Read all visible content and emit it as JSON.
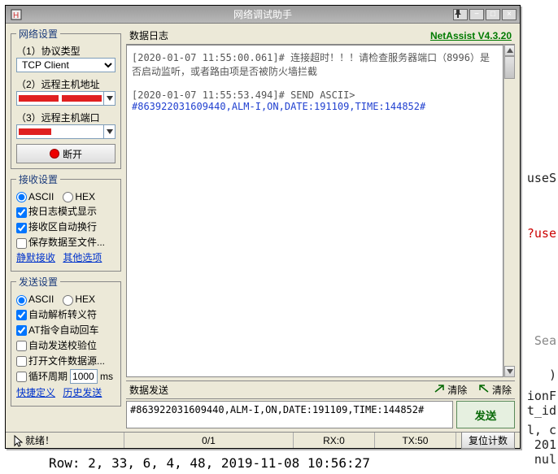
{
  "window": {
    "title": "网络调试助手",
    "version_label": "NetAssist V4.3.20"
  },
  "titlebar_buttons": {
    "pin": "pin-icon",
    "min": "−",
    "max": "□",
    "close": "×"
  },
  "network": {
    "legend": "网络设置",
    "protocol_label": "（1）协议类型",
    "protocol_value": "TCP Client",
    "host_label": "（2）远程主机地址",
    "port_label": "（3）远程主机端口",
    "disconnect_label": "断开"
  },
  "recv": {
    "legend": "接收设置",
    "ascii": "ASCII",
    "hex": "HEX",
    "log_mode": "按日志模式显示",
    "autowrap": "接收区自动换行",
    "save_file": "保存数据至文件...",
    "silent": "静默接收",
    "other": "其他选项"
  },
  "send": {
    "legend": "发送设置",
    "ascii": "ASCII",
    "hex": "HEX",
    "escape": "自动解析转义符",
    "at_return": "AT指令自动回车",
    "checksum": "自动发送校验位",
    "open_file": "打开文件数据源...",
    "loop_label": "循环周期",
    "loop_value": "1000",
    "loop_unit": "ms",
    "quick": "快捷定义",
    "history": "历史发送"
  },
  "log": {
    "header": "数据日志",
    "line1": "[2020-01-07 11:55:00.061]# 连接超时！！！请检查服务器端口（8996）是否启动监听，或者路由项是否被防火墙拦截",
    "line2_head": "[2020-01-07 11:55:53.494]# SEND ASCII>",
    "line2_body": "#863922031609440,ALM-I,ON,DATE:191109,TIME:144852#"
  },
  "sendbox": {
    "header": "数据发送",
    "clear1": "清除",
    "clear2": "清除",
    "value": "#863922031609440,ALM-I,ON,DATE:191109,TIME:144852#",
    "button": "发送"
  },
  "status": {
    "ready": "就绪！",
    "progress": "0/1",
    "rx": "RX:0",
    "tx": "TX:50",
    "reset": "复位计数"
  },
  "background": {
    "t1": "useS",
    "t2": "?use",
    "t3": "Sea",
    "t4": ")",
    "t5": "ionF",
    "t6": "t_id",
    "t7": "l, c",
    "t8": "201",
    "t9": "nul",
    "bottom": "Row: 2, 33, 6, 4, 48, 2019-11-08 10:56:27"
  }
}
